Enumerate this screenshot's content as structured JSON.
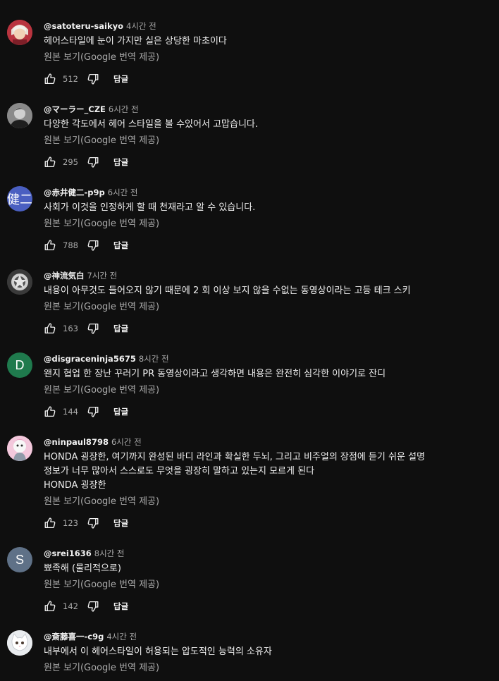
{
  "comments": [
    {
      "author": "@satoteru-saikyo",
      "time": "4시간 전",
      "lines": [
        "헤어스타일에 눈이 가지만 실은 상당한 마초이다"
      ],
      "translate_label": "원본 보기(Google 번역 제공)",
      "likes": "512",
      "reply_label": "답글",
      "avatar": {
        "icon": "anime-character-avatar",
        "bg": "#b9343f"
      }
    },
    {
      "author": "@マーラー_CZE",
      "time": "6시간 전",
      "lines": [
        "다양한 각도에서 헤어 스타일을 볼 수있어서 고맙습니다."
      ],
      "translate_label": "원본 보기(Google 번역 제공)",
      "likes": "295",
      "reply_label": "답글",
      "avatar": {
        "icon": "portrait-photo-avatar",
        "bg": "#6b6b6b"
      }
    },
    {
      "author": "@赤井健二-p9p",
      "time": "6시간 전",
      "lines": [
        "사회가 이것을 인정하게 할 때 천재라고 알 수 있습니다."
      ],
      "translate_label": "원본 보기(Google 번역 제공)",
      "likes": "788",
      "reply_label": "답글",
      "avatar": {
        "letter": "健二",
        "bg": "#4a5fc1"
      }
    },
    {
      "author": "@神流気白",
      "time": "7시간 전",
      "lines": [
        "내용이 아무것도 들어오지 않기 때문에 2 회 이상 보지 않을 수없는 동영상이라는 고등 테크 스키"
      ],
      "translate_label": "원본 보기(Google 번역 제공)",
      "likes": "163",
      "reply_label": "답글",
      "avatar": {
        "icon": "emblem-avatar",
        "bg": "#3a3a3a"
      }
    },
    {
      "author": "@disgraceninja5675",
      "time": "8시간 전",
      "lines": [
        "왠지 협업 한 장난 꾸러기 PR 동영상이라고 생각하면 내용은 완전히 심각한 이야기로 잔디"
      ],
      "translate_label": "원본 보기(Google 번역 제공)",
      "likes": "144",
      "reply_label": "답글",
      "avatar": {
        "letter": "D",
        "bg": "#1f7a4d"
      }
    },
    {
      "author": "@ninpaul8798",
      "time": "6시간 전",
      "lines": [
        "HONDA 굉장한, 여기까지 완성된 바디 라인과 확실한 두뇌, 그리고 비주얼의 장점에 듣기 쉬운 설명",
        "정보가 너무 많아서 스스로도 무엇을 굉장히 말하고 있는지 모르게 된다",
        "HONDA 굉장한"
      ],
      "translate_label": "원본 보기(Google 번역 제공)",
      "likes": "123",
      "reply_label": "답글",
      "avatar": {
        "icon": "pink-character-avatar",
        "bg": "#e8a7c4"
      }
    },
    {
      "author": "@srei1636",
      "time": "8시간 전",
      "lines": [
        "뾰족해 (물리적으로)"
      ],
      "translate_label": "원본 보기(Google 번역 제공)",
      "likes": "142",
      "reply_label": "답글",
      "avatar": {
        "letter": "S",
        "bg": "#5f7187"
      }
    },
    {
      "author": "@斎藤喜一-c9g",
      "time": "4시간 전",
      "lines": [
        "내부에서 이 헤어스타일이 허용되는 압도적인 능력의 소유자"
      ],
      "translate_label": "원본 보기(Google 번역 제공)",
      "likes": "",
      "reply_label": "",
      "avatar": {
        "icon": "white-cat-avatar",
        "bg": "#e9ecef"
      }
    }
  ],
  "colors": {
    "background": "#0f0f0f",
    "text_primary": "#f1f1f1",
    "text_secondary": "#aaaaaa"
  }
}
